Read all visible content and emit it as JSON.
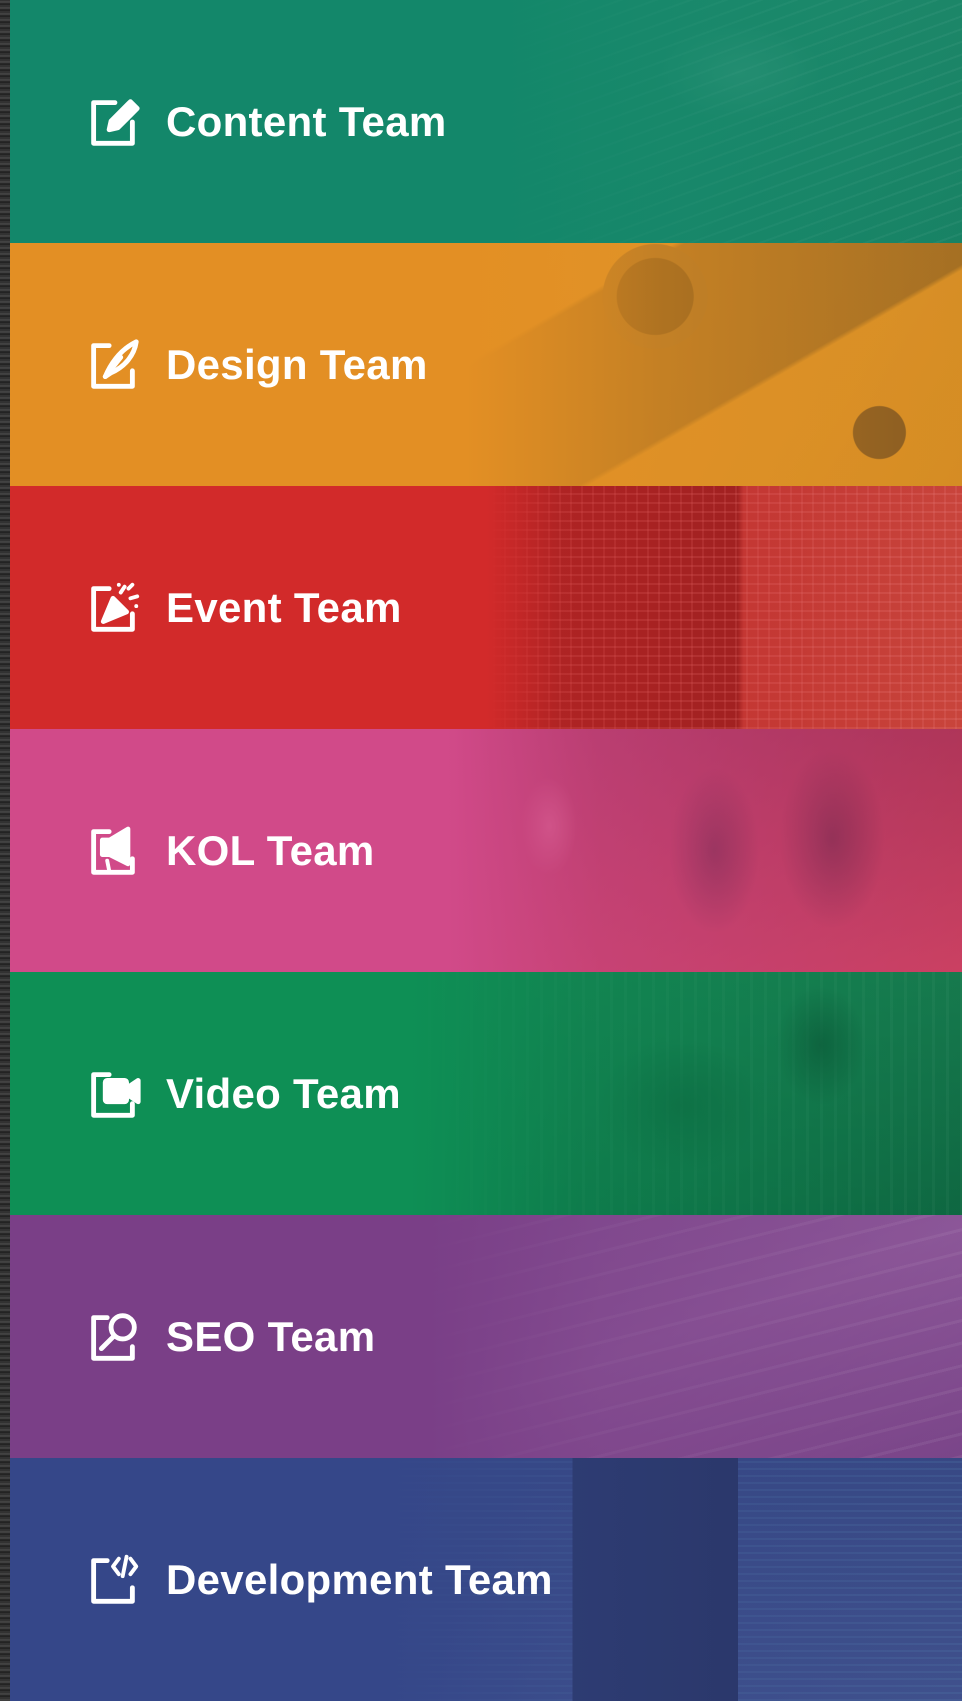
{
  "teams": [
    {
      "label": "Content Team",
      "icon": "edit-pen-icon",
      "color": "#13876a"
    },
    {
      "label": "Design Team",
      "icon": "feather-quill-icon",
      "color": "#e38f24"
    },
    {
      "label": "Event Team",
      "icon": "party-popper-icon",
      "color": "#d22a2a"
    },
    {
      "label": "KOL Team",
      "icon": "megaphone-icon",
      "color": "#d14a89"
    },
    {
      "label": "Video Team",
      "icon": "video-camera-icon",
      "color": "#0e8f55"
    },
    {
      "label": "SEO Team",
      "icon": "magnifier-search-icon",
      "color": "#7a3f87"
    },
    {
      "label": "Development Team",
      "icon": "code-tag-icon",
      "color": "#354789"
    }
  ]
}
